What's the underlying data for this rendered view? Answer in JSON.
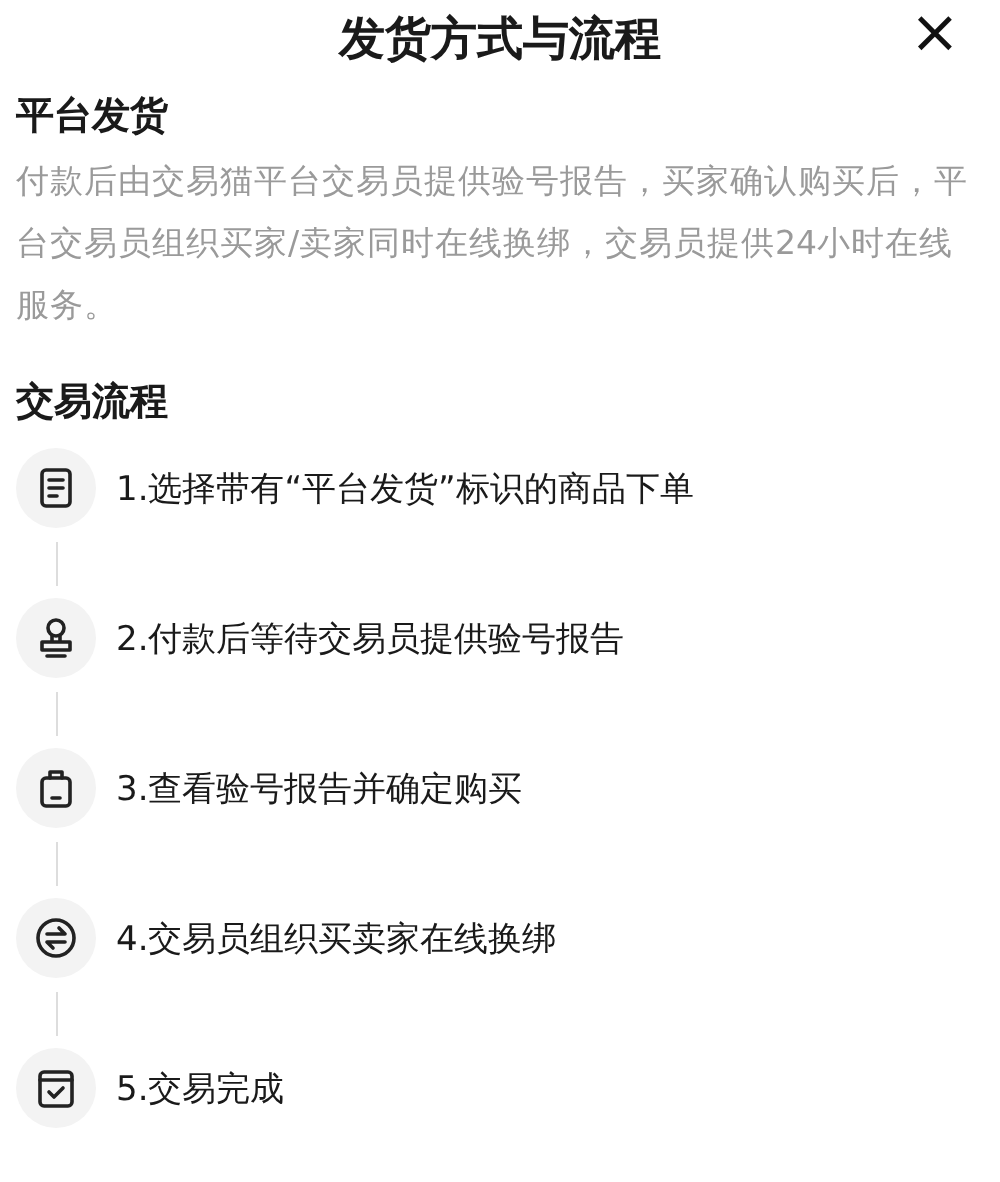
{
  "header": {
    "title": "发货方式与流程",
    "close": "×"
  },
  "delivery": {
    "heading": "平台发货",
    "description": "付款后由交易猫平台交易员提供验号报告，买家确认购买后，平台交易员组织买家/卖家同时在线换绑，交易员提供24小时在线服务。"
  },
  "process": {
    "heading": "交易流程",
    "steps": [
      {
        "kind": "document",
        "text": "1.选择带有“平台发货”标识的商品下单"
      },
      {
        "kind": "stamp",
        "text": "2.付款后等待交易员提供验号报告"
      },
      {
        "kind": "bag",
        "text": "3.查看验号报告并确定购买"
      },
      {
        "kind": "exchange",
        "text": "4.交易员组织买卖家在线换绑"
      },
      {
        "kind": "calendar",
        "text": "5.交易完成"
      }
    ]
  }
}
